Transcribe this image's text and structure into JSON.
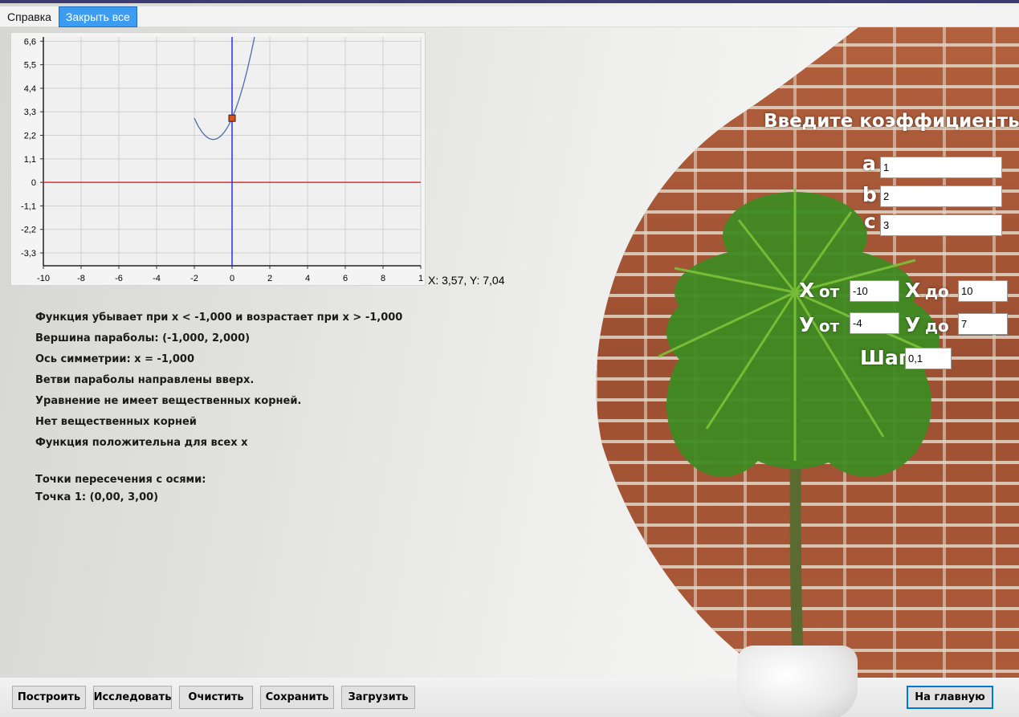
{
  "menu": {
    "items": [
      "Справка",
      "Закрыть все"
    ]
  },
  "chart_data": {
    "type": "line",
    "function": "y = x^2 + 2x + 3",
    "series": [
      {
        "x": [
          -2.0,
          -1.8,
          -1.6,
          -1.4,
          -1.2,
          -1.0,
          -0.8,
          -0.6,
          -0.4,
          -0.2,
          0.0,
          0.2,
          0.4,
          0.6,
          0.8,
          1.0,
          1.2
        ],
        "y": [
          3.0,
          2.64,
          2.36,
          2.16,
          2.04,
          2.0,
          2.04,
          2.16,
          2.36,
          2.64,
          3.0,
          3.44,
          3.96,
          4.56,
          5.24,
          6.0,
          6.84
        ]
      }
    ],
    "marker": {
      "x": 0,
      "y": 3
    },
    "xlim": [
      -10,
      10
    ],
    "ylim": [
      -3.9,
      6.8
    ],
    "xticks": [
      "-10",
      "-8",
      "-6",
      "-4",
      "-2",
      "0",
      "2",
      "4",
      "6",
      "8",
      "1"
    ],
    "yticks": [
      "6,6",
      "5,5",
      "4,4",
      "3,3",
      "2,2",
      "1,1",
      "0",
      "-1,1",
      "-2,2",
      "-3,3"
    ],
    "colors": {
      "curve": "#4a6fb0",
      "x_axis": "#e03030",
      "y_axis": "#2a2af0",
      "marker": "#e05010"
    },
    "grid": true
  },
  "coord_readout": "X: 3,57, Y: 7,04",
  "analysis": {
    "lines": [
      "Функция убывает при x < -1,000 и возрастает при x > -1,000",
      "Вершина параболы: (-1,000, 2,000)",
      "Ось симметрии: x = -1,000",
      "Ветви параболы направлены вверх.",
      "Уравнение не имеет вещественных корней.",
      "Нет вещественных корней",
      "Функция положительна для всех x"
    ],
    "intersections_title": "Точки пересечения с осями:",
    "point1": "Точка 1: (0,00, 3,00)"
  },
  "coefficients": {
    "heading": "Введите коэффициенты",
    "a_label": "a",
    "a_value": "1",
    "b_label": "b",
    "b_value": "2",
    "c_label": "c",
    "c_value": "3"
  },
  "range": {
    "x_from_label": "X",
    "from_word": "от",
    "x_from_value": "-10",
    "x_to_label": "X",
    "to_word": "до",
    "x_to_value": "10",
    "y_from_label": "У",
    "y_from_value": "-4",
    "y_to_label": "У",
    "y_to_value": "7",
    "step_label": "Шаг",
    "step_value": "0,1"
  },
  "buttons": {
    "build": "Построить",
    "analyze": "Исследовать",
    "clear": "Очистить",
    "save": "Сохранить",
    "load": "Загрузить",
    "home": "На главную"
  }
}
